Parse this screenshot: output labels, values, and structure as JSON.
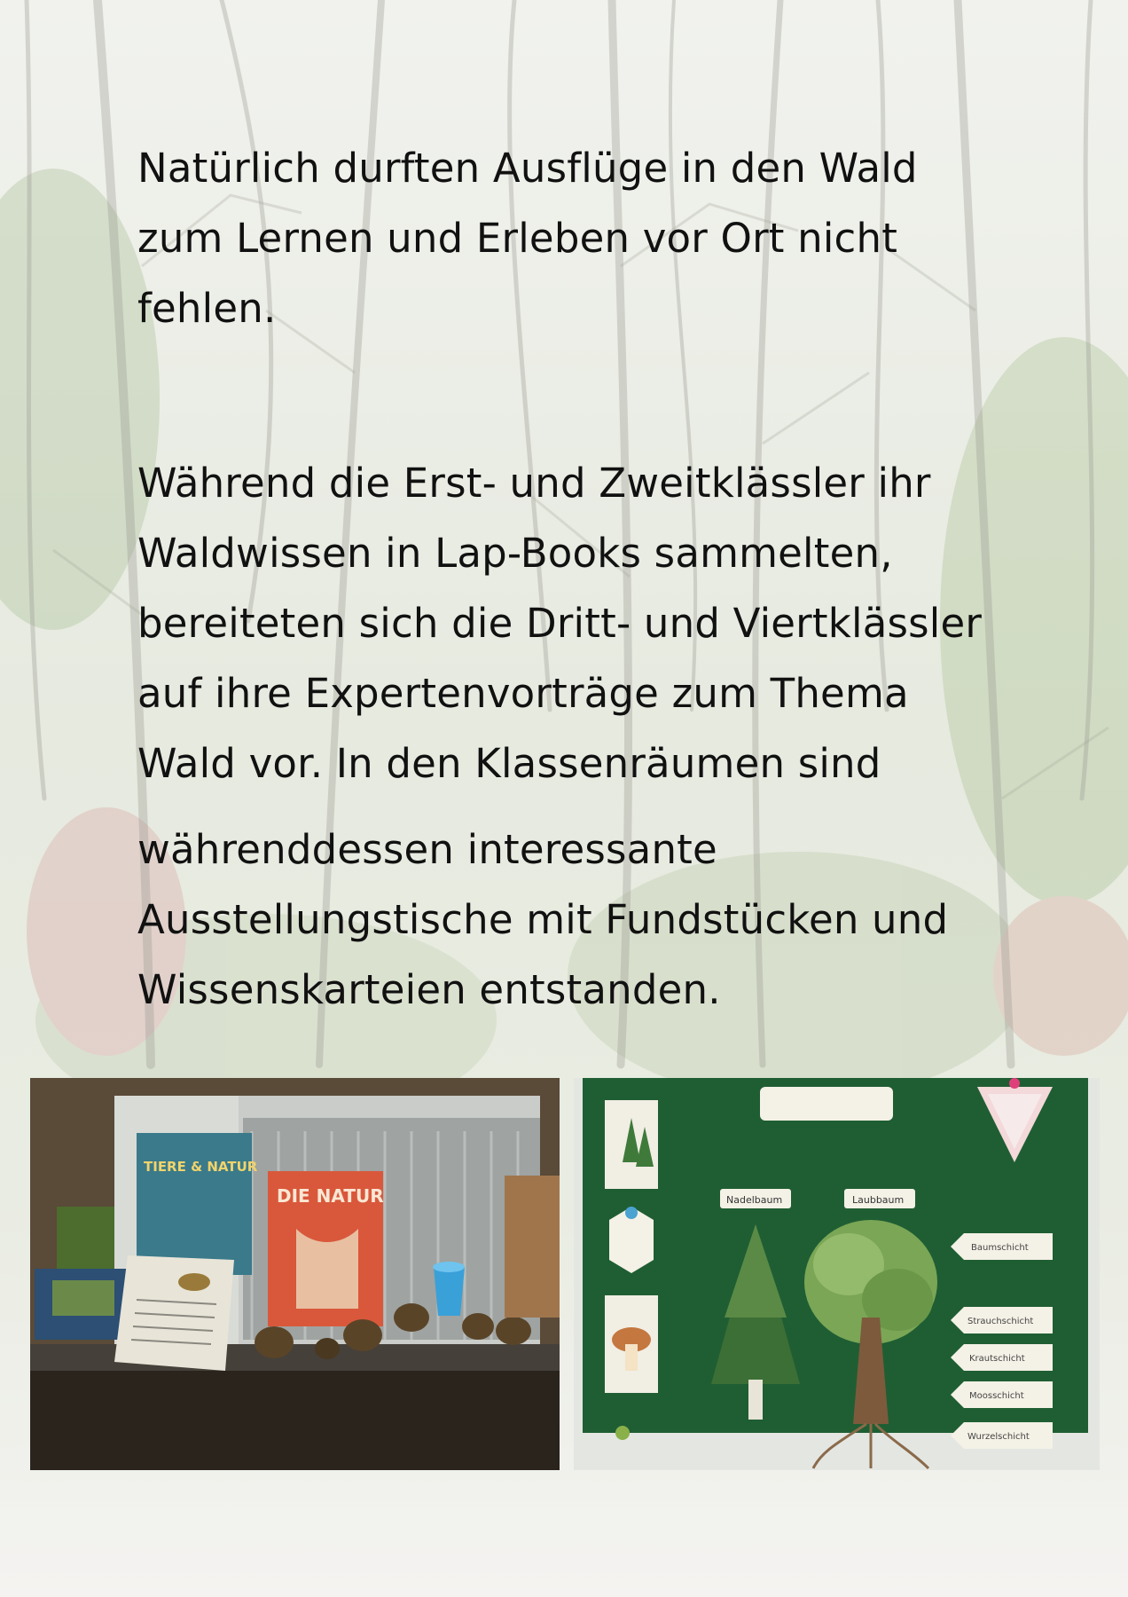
{
  "paragraphs": [
    {
      "lines": [
        "Natürlich durften Ausflüge in den Wald",
        "zum Lernen und Erleben vor Ort nicht",
        "fehlen."
      ]
    },
    {
      "lines": [
        "Während die Erst- und Zweitklässler ihr",
        "Waldwissen in Lap-Books sammelten,",
        "bereiteten sich die Dritt- und Viertklässler",
        "auf ihre Expertenvorträge zum Thema",
        "Wald vor. In den Klassenräumen sind"
      ]
    },
    {
      "lines": [
        "währenddessen interessante",
        "Ausstellungstische mit Fundstücken und",
        "Wissenskarteien entstanden."
      ]
    }
  ],
  "photos": {
    "left": {
      "book_title": "DIE NATUR",
      "book2_title": "TIERE & NATUR"
    },
    "right": {
      "labels": [
        "Baumschicht",
        "Strauchschicht",
        "Krautschicht",
        "Moosschicht",
        "Wurzelschicht"
      ],
      "top_left_label": "Nadelbaum",
      "top_right_label": "Laubbaum"
    }
  },
  "colors": {
    "text": "#111111",
    "board_green": "#1f5e33"
  }
}
